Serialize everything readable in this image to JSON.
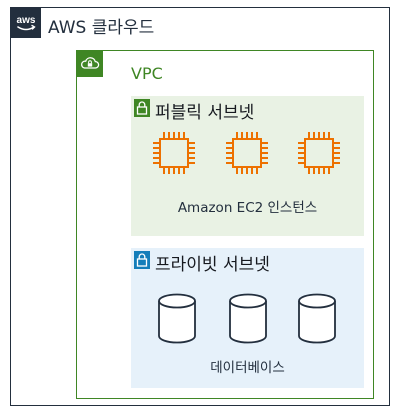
{
  "cloud": {
    "badge_text": "aws",
    "label": "AWS 클라우드",
    "border_color": "#232f3e"
  },
  "vpc": {
    "label": "VPC",
    "color": "#3f8624"
  },
  "public_subnet": {
    "label": "퍼블릭 서브넷",
    "background": "#e9f2e4",
    "lock_color": "#3f8624",
    "instance_icon": "ec2-instance-icon",
    "instance_count": 3,
    "caption": "Amazon EC2 인스턴스"
  },
  "private_subnet": {
    "label": "프라이빗 서브넷",
    "background": "#e6f1fa",
    "lock_color": "#147eba",
    "database_icon": "database-icon",
    "database_count": 3,
    "caption": "데이터베이스"
  },
  "colors": {
    "ec2_orange": "#ed7100",
    "icon_outline": "#232f3e"
  }
}
